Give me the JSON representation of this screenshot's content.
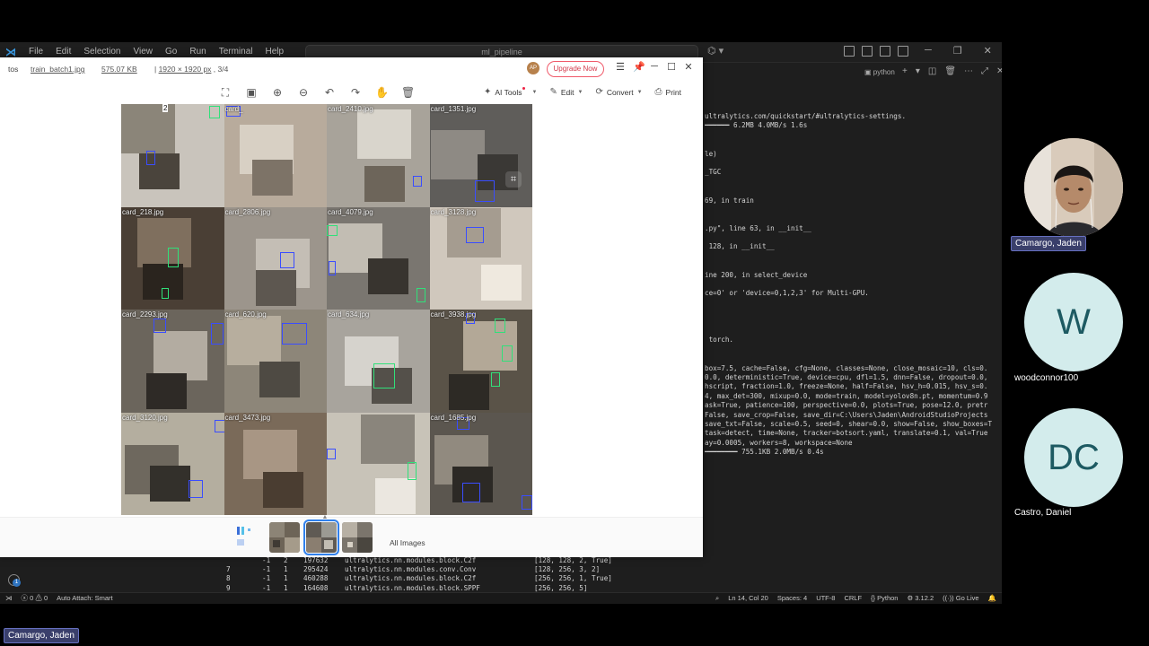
{
  "vscode": {
    "menu": [
      "File",
      "Edit",
      "Selection",
      "View",
      "Go",
      "Run",
      "Terminal",
      "Help"
    ],
    "search_text": "ml_pipeline",
    "terminal_kind": "python",
    "terminal_lines": [
      "ultralytics.com/quickstart/#ultralytics-settings.",
      "━━━━━━ 6.2MB 4.0MB/s 1.6s",
      "",
      "",
      "le)",
      "",
      "_TGC",
      "",
      "",
      "69, in train",
      "",
      "",
      ".py\", line 63, in __init__",
      "",
      " 128, in __init__",
      "",
      "",
      "ine 200, in select_device",
      "",
      "ce=0' or 'device=0,1,2,3' for Multi-GPU.",
      "",
      "",
      "",
      "",
      " torch.",
      "",
      "",
      "box=7.5, cache=False, cfg=None, classes=None, close_mosaic=10, cls=0.",
      "0.0, deterministic=True, device=cpu, dfl=1.5, dnn=False, dropout=0.0,",
      "hscript, fraction=1.0, freeze=None, half=False, hsv_h=0.015, hsv_s=0.",
      "4, max_det=300, mixup=0.0, mode=train, model=yolov8n.pt, momentum=0.9",
      "ask=True, patience=100, perspective=0.0, plots=True, pose=12.0, pretr",
      "False, save_crop=False, save_dir=C:\\Users\\Jaden\\AndroidStudioProjects",
      "save_txt=False, scale=0.5, seed=0, shear=0.0, show=False, show_boxes=T",
      "task=detect, time=None, tracker=botsort.yaml, translate=0.1, val=True",
      "ay=0.0005, workers=8, workspace=None",
      "━━━━━━━━ 755.1KB 2.0MB/s 0.4s"
    ],
    "model_table": [
      {
        "idx": "",
        "from": "-1",
        "n": "2",
        "params": "197632",
        "module": "ultralytics.nn.modules.block.C2f",
        "args": "[128, 128, 2, True]"
      },
      {
        "idx": "7",
        "from": "-1",
        "n": "1",
        "params": "295424",
        "module": "ultralytics.nn.modules.conv.Conv",
        "args": "[128, 256, 3, 2]"
      },
      {
        "idx": "8",
        "from": "-1",
        "n": "1",
        "params": "460288",
        "module": "ultralytics.nn.modules.block.C2f",
        "args": "[256, 256, 1, True]"
      },
      {
        "idx": "9",
        "from": "-1",
        "n": "1",
        "params": "164608",
        "module": "ultralytics.nn.modules.block.SPPF",
        "args": "[256, 256, 5]"
      }
    ],
    "status": {
      "errors": "0",
      "warnings": "0",
      "auto_attach": "Auto Attach: Smart",
      "cursor": "Ln 14, Col 20",
      "spaces": "Spaces: 4",
      "encoding": "UTF-8",
      "eol": "CRLF",
      "language": "Python",
      "python_version": "3.12.2",
      "go_live": "Go Live"
    }
  },
  "viewer": {
    "left_label": "tos",
    "filename": "train_batch1.jpg",
    "filesize": "575.07 KB",
    "dimensions": "1920 × 1920 px",
    "page": "3/4",
    "avatar_initials": "AP",
    "upgrade_label": "Upgrade Now",
    "actions": {
      "ai_tools": "AI Tools",
      "edit": "Edit",
      "convert": "Convert",
      "print": "Print"
    },
    "all_images_label": "All Images",
    "tiles": [
      {
        "label": "",
        "num": "2"
      },
      {
        "label": "card_",
        "num": ""
      },
      {
        "label": "card_2410.jpg",
        "num": ""
      },
      {
        "label": "card_1351.jpg",
        "num": ""
      },
      {
        "label": "card_218.jpg",
        "num": ""
      },
      {
        "label": "card_2806.jpg",
        "num": ""
      },
      {
        "label": "card_4079.jpg",
        "num": ""
      },
      {
        "label": "card_3128.jpg",
        "num": ""
      },
      {
        "label": "card_2293.jpg",
        "num": ""
      },
      {
        "label": "card_620.jpg",
        "num": ""
      },
      {
        "label": "card_634.jpg",
        "num": ""
      },
      {
        "label": "card_3938.jpg",
        "num": ""
      },
      {
        "label": "card_3120.jpg",
        "num": ""
      },
      {
        "label": "card_3473.jpg",
        "num": ""
      },
      {
        "label": "",
        "num": ""
      },
      {
        "label": "card_1685.jpg",
        "num": ""
      }
    ]
  },
  "participants": {
    "p1_name": "Camargo, Jaden",
    "p2_initial": "W",
    "p2_name": "woodconnor100",
    "p3_initial": "DC",
    "p3_name": "Castro, Daniel",
    "bottom_name": "Camargo, Jaden"
  },
  "colors": {
    "upgrade": "#d2384a",
    "participant_tag": "#3a3f6b",
    "bbox_green": "#31e07a",
    "bbox_blue": "#3a4dff",
    "avatar_bg": "#d3ecec"
  }
}
